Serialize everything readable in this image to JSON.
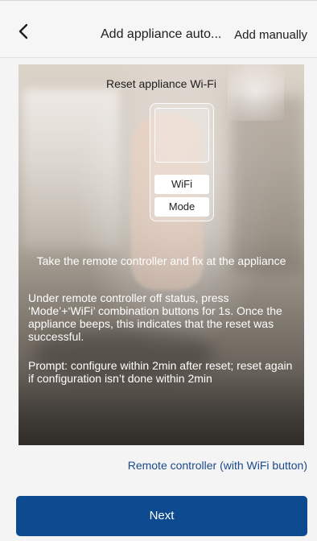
{
  "header": {
    "back_icon": "chevron-left-icon",
    "title": "Add appliance auto...",
    "add_manually_label": "Add manually"
  },
  "illustration": {
    "heading": "Reset appliance Wi-Fi",
    "remote": {
      "wifi_button": "WiFi",
      "mode_button": "Mode"
    },
    "caption": "Take the remote controller and fix at the appliance",
    "instruction": "Under remote controller off status, press ‘Mode’+‘WiFi’ combination buttons for 1s. Once the appliance beeps, this indicates that the reset was successful.",
    "prompt": "Prompt: configure within 2min after reset; reset again if configuration isn’t done within 2min"
  },
  "remote_type_link": "Remote controller (with WiFi button)",
  "next_button_label": "Next",
  "colors": {
    "primary": "#0e4a8f",
    "link": "#1a4a8c",
    "background": "#f4f4f4"
  }
}
